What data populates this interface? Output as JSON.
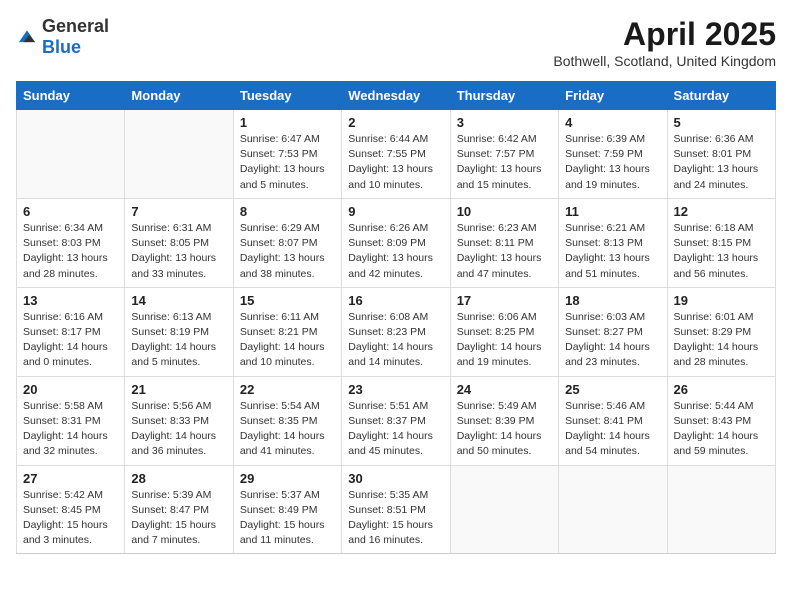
{
  "header": {
    "logo_general": "General",
    "logo_blue": "Blue",
    "month_title": "April 2025",
    "location": "Bothwell, Scotland, United Kingdom"
  },
  "weekdays": [
    "Sunday",
    "Monday",
    "Tuesday",
    "Wednesday",
    "Thursday",
    "Friday",
    "Saturday"
  ],
  "weeks": [
    [
      {
        "day": "",
        "info": ""
      },
      {
        "day": "",
        "info": ""
      },
      {
        "day": "1",
        "info": "Sunrise: 6:47 AM\nSunset: 7:53 PM\nDaylight: 13 hours and 5 minutes."
      },
      {
        "day": "2",
        "info": "Sunrise: 6:44 AM\nSunset: 7:55 PM\nDaylight: 13 hours and 10 minutes."
      },
      {
        "day": "3",
        "info": "Sunrise: 6:42 AM\nSunset: 7:57 PM\nDaylight: 13 hours and 15 minutes."
      },
      {
        "day": "4",
        "info": "Sunrise: 6:39 AM\nSunset: 7:59 PM\nDaylight: 13 hours and 19 minutes."
      },
      {
        "day": "5",
        "info": "Sunrise: 6:36 AM\nSunset: 8:01 PM\nDaylight: 13 hours and 24 minutes."
      }
    ],
    [
      {
        "day": "6",
        "info": "Sunrise: 6:34 AM\nSunset: 8:03 PM\nDaylight: 13 hours and 28 minutes."
      },
      {
        "day": "7",
        "info": "Sunrise: 6:31 AM\nSunset: 8:05 PM\nDaylight: 13 hours and 33 minutes."
      },
      {
        "day": "8",
        "info": "Sunrise: 6:29 AM\nSunset: 8:07 PM\nDaylight: 13 hours and 38 minutes."
      },
      {
        "day": "9",
        "info": "Sunrise: 6:26 AM\nSunset: 8:09 PM\nDaylight: 13 hours and 42 minutes."
      },
      {
        "day": "10",
        "info": "Sunrise: 6:23 AM\nSunset: 8:11 PM\nDaylight: 13 hours and 47 minutes."
      },
      {
        "day": "11",
        "info": "Sunrise: 6:21 AM\nSunset: 8:13 PM\nDaylight: 13 hours and 51 minutes."
      },
      {
        "day": "12",
        "info": "Sunrise: 6:18 AM\nSunset: 8:15 PM\nDaylight: 13 hours and 56 minutes."
      }
    ],
    [
      {
        "day": "13",
        "info": "Sunrise: 6:16 AM\nSunset: 8:17 PM\nDaylight: 14 hours and 0 minutes."
      },
      {
        "day": "14",
        "info": "Sunrise: 6:13 AM\nSunset: 8:19 PM\nDaylight: 14 hours and 5 minutes."
      },
      {
        "day": "15",
        "info": "Sunrise: 6:11 AM\nSunset: 8:21 PM\nDaylight: 14 hours and 10 minutes."
      },
      {
        "day": "16",
        "info": "Sunrise: 6:08 AM\nSunset: 8:23 PM\nDaylight: 14 hours and 14 minutes."
      },
      {
        "day": "17",
        "info": "Sunrise: 6:06 AM\nSunset: 8:25 PM\nDaylight: 14 hours and 19 minutes."
      },
      {
        "day": "18",
        "info": "Sunrise: 6:03 AM\nSunset: 8:27 PM\nDaylight: 14 hours and 23 minutes."
      },
      {
        "day": "19",
        "info": "Sunrise: 6:01 AM\nSunset: 8:29 PM\nDaylight: 14 hours and 28 minutes."
      }
    ],
    [
      {
        "day": "20",
        "info": "Sunrise: 5:58 AM\nSunset: 8:31 PM\nDaylight: 14 hours and 32 minutes."
      },
      {
        "day": "21",
        "info": "Sunrise: 5:56 AM\nSunset: 8:33 PM\nDaylight: 14 hours and 36 minutes."
      },
      {
        "day": "22",
        "info": "Sunrise: 5:54 AM\nSunset: 8:35 PM\nDaylight: 14 hours and 41 minutes."
      },
      {
        "day": "23",
        "info": "Sunrise: 5:51 AM\nSunset: 8:37 PM\nDaylight: 14 hours and 45 minutes."
      },
      {
        "day": "24",
        "info": "Sunrise: 5:49 AM\nSunset: 8:39 PM\nDaylight: 14 hours and 50 minutes."
      },
      {
        "day": "25",
        "info": "Sunrise: 5:46 AM\nSunset: 8:41 PM\nDaylight: 14 hours and 54 minutes."
      },
      {
        "day": "26",
        "info": "Sunrise: 5:44 AM\nSunset: 8:43 PM\nDaylight: 14 hours and 59 minutes."
      }
    ],
    [
      {
        "day": "27",
        "info": "Sunrise: 5:42 AM\nSunset: 8:45 PM\nDaylight: 15 hours and 3 minutes."
      },
      {
        "day": "28",
        "info": "Sunrise: 5:39 AM\nSunset: 8:47 PM\nDaylight: 15 hours and 7 minutes."
      },
      {
        "day": "29",
        "info": "Sunrise: 5:37 AM\nSunset: 8:49 PM\nDaylight: 15 hours and 11 minutes."
      },
      {
        "day": "30",
        "info": "Sunrise: 5:35 AM\nSunset: 8:51 PM\nDaylight: 15 hours and 16 minutes."
      },
      {
        "day": "",
        "info": ""
      },
      {
        "day": "",
        "info": ""
      },
      {
        "day": "",
        "info": ""
      }
    ]
  ]
}
